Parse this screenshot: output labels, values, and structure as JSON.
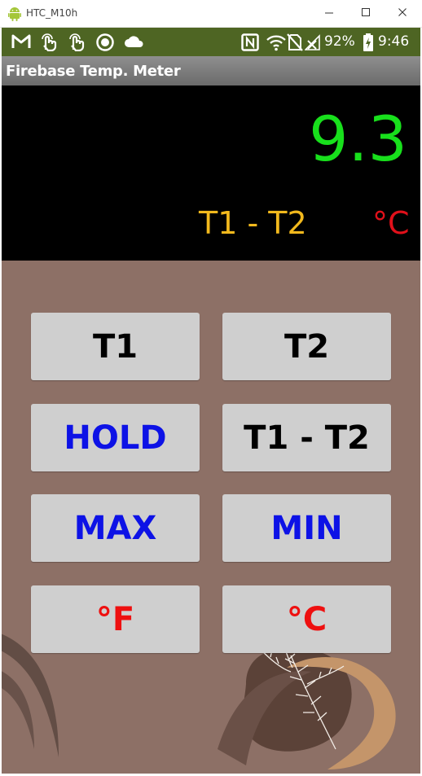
{
  "window": {
    "title": "HTC_M10h",
    "icons": {
      "app": "android-icon",
      "minimize": "minimize-icon",
      "maximize": "maximize-icon",
      "close": "close-icon"
    }
  },
  "status_bar": {
    "battery": "92%",
    "time": "9:46",
    "left_icons": [
      "gmail-icon",
      "touch-icon",
      "touch-icon",
      "record-icon",
      "cloud-icon"
    ],
    "right_icons": [
      "nfc-icon",
      "wifi-icon",
      "no-sim-icon",
      "no-signal-icon",
      "battery-charging-icon"
    ],
    "color": "#4e6523"
  },
  "app_bar": {
    "title": "Firebase Temp. Meter"
  },
  "display": {
    "reading": "9.3",
    "mode": "T1 - T2",
    "unit": "°C",
    "colors": {
      "reading": "#18e01c",
      "mode": "#f2b91d",
      "unit": "#e0101a"
    }
  },
  "buttons": {
    "t1": "T1",
    "t2": "T2",
    "hold": "HOLD",
    "diff": "T1 - T2",
    "max": "MAX",
    "min": "MIN",
    "fahrenheit": "°F",
    "celsius": "°C"
  },
  "panel": {
    "background": "#8d7066"
  }
}
